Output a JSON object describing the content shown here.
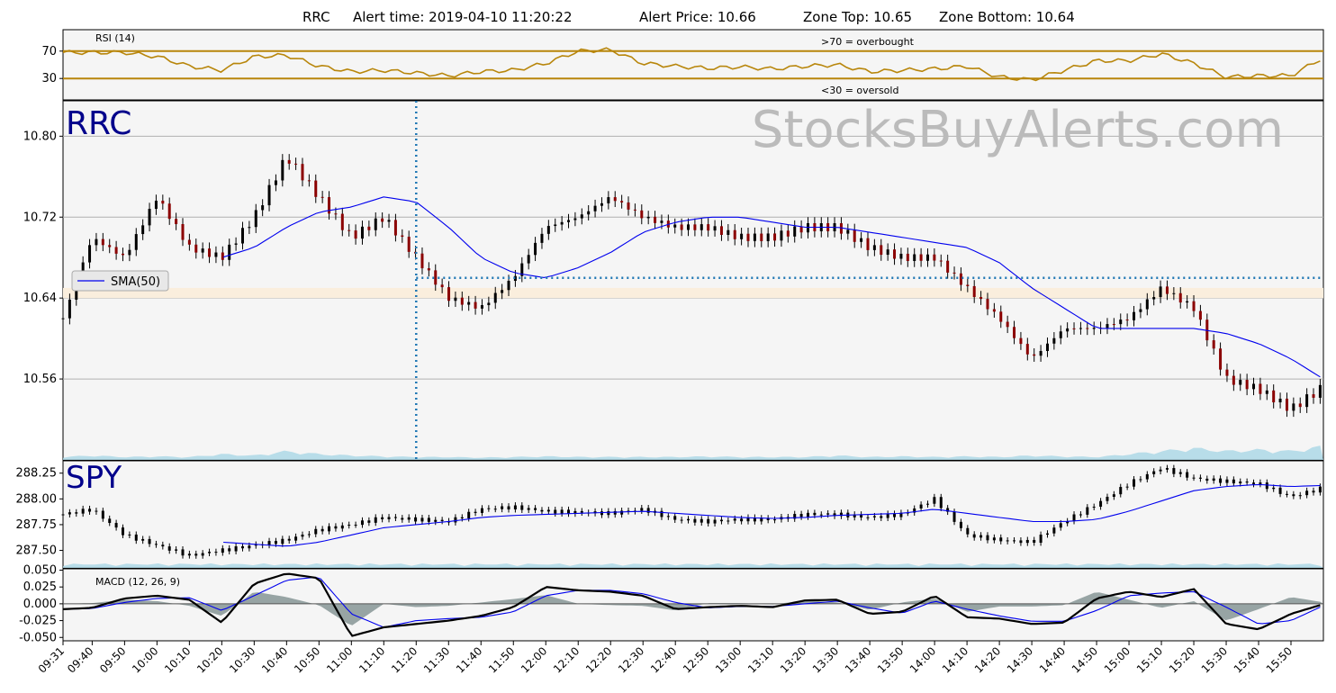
{
  "header": {
    "symbol": "RRC",
    "alert_time_text": "Alert time: 2019-04-10 11:20:22",
    "alert_price_text": "Alert Price: 10.66",
    "zone_top_text": "Zone Top: 10.65",
    "zone_bottom_text": "Zone Bottom: 10.64"
  },
  "watermark": "StocksBuyAlerts.com",
  "colors": {
    "panel_bg": "#f5f5f5",
    "rsi_line": "#b8860b",
    "sma_line": "#0000ee",
    "volume_fill": "#add8e6",
    "zone_fill": "#faeedd",
    "alert_line": "#1f77b4",
    "macd_line": "#000000",
    "signal_line": "#0000ee",
    "hist_fill": "#7f9090",
    "symbol_text": "#00008b",
    "watermark_text": "#bbbbbb"
  },
  "chart_data": [
    {
      "panel": "rsi",
      "type": "line",
      "title": "RSI (14)",
      "yticks": [
        "70",
        "30"
      ],
      "ylim": [
        0,
        100
      ],
      "levels": [
        70,
        30
      ],
      "overbought_text": ">70 = overbought",
      "oversold_text": "<30 = oversold",
      "x": [
        "09:31",
        "09:40",
        "09:50",
        "10:00",
        "10:10",
        "10:20",
        "10:30",
        "10:40",
        "10:50",
        "11:00",
        "11:10",
        "11:20",
        "11:30",
        "11:40",
        "11:50",
        "12:00",
        "12:10",
        "12:20",
        "12:30",
        "12:40",
        "12:50",
        "13:00",
        "13:10",
        "13:20",
        "13:30",
        "13:40",
        "13:50",
        "14:00",
        "14:10",
        "14:20",
        "14:30",
        "14:40",
        "14:50",
        "15:00",
        "15:10",
        "15:20",
        "15:30",
        "15:40",
        "15:50",
        "15:59"
      ],
      "values": [
        68,
        68,
        68,
        62,
        48,
        42,
        62,
        64,
        48,
        40,
        42,
        38,
        34,
        40,
        42,
        52,
        70,
        72,
        52,
        48,
        45,
        47,
        44,
        48,
        50,
        40,
        42,
        44,
        48,
        32,
        28,
        42,
        56,
        56,
        66,
        52,
        32,
        34,
        34,
        58
      ]
    },
    {
      "panel": "price",
      "type": "candlestick",
      "symbol_label": "RRC",
      "yticks": [
        "10.80",
        "10.72",
        "10.64",
        "10.56"
      ],
      "ylim": [
        10.48,
        10.835
      ],
      "legend": "SMA(50)",
      "legend_position": "left",
      "alert_time": "11:20",
      "alert_price": 10.66,
      "zone": [
        10.64,
        10.65
      ],
      "x": [
        "09:31",
        "09:40",
        "09:50",
        "10:00",
        "10:10",
        "10:20",
        "10:30",
        "10:40",
        "10:50",
        "11:00",
        "11:10",
        "11:20",
        "11:30",
        "11:40",
        "11:50",
        "12:00",
        "12:10",
        "12:20",
        "12:30",
        "12:40",
        "12:50",
        "13:00",
        "13:10",
        "13:20",
        "13:30",
        "13:40",
        "13:50",
        "14:00",
        "14:10",
        "14:20",
        "14:30",
        "14:40",
        "14:50",
        "15:00",
        "15:10",
        "15:20",
        "15:30",
        "15:40",
        "15:50",
        "15:59"
      ],
      "close": [
        10.62,
        10.7,
        10.68,
        10.74,
        10.69,
        10.68,
        10.72,
        10.78,
        10.74,
        10.7,
        10.72,
        10.68,
        10.64,
        10.63,
        10.66,
        10.71,
        10.72,
        10.74,
        10.72,
        10.71,
        10.71,
        10.7,
        10.7,
        10.71,
        10.71,
        10.69,
        10.68,
        10.68,
        10.65,
        10.62,
        10.58,
        10.61,
        10.61,
        10.62,
        10.65,
        10.63,
        10.56,
        10.55,
        10.53,
        10.55
      ],
      "sma": [
        null,
        null,
        null,
        null,
        null,
        10.68,
        10.69,
        10.71,
        10.725,
        10.73,
        10.74,
        10.735,
        10.71,
        10.68,
        10.665,
        10.66,
        10.67,
        10.685,
        10.705,
        10.715,
        10.72,
        10.72,
        10.715,
        10.71,
        10.71,
        10.705,
        10.7,
        10.695,
        10.69,
        10.675,
        10.65,
        10.63,
        10.61,
        10.61,
        10.61,
        10.61,
        10.605,
        10.595,
        10.58,
        10.562
      ],
      "volume_relative": [
        0.1,
        0.15,
        0.1,
        0.12,
        0.1,
        0.2,
        0.15,
        0.3,
        0.2,
        0.15,
        0.12,
        0.1,
        0.1,
        0.08,
        0.1,
        0.12,
        0.1,
        0.1,
        0.1,
        0.1,
        0.12,
        0.1,
        0.1,
        0.1,
        0.15,
        0.1,
        0.12,
        0.1,
        0.12,
        0.1,
        0.15,
        0.12,
        0.1,
        0.2,
        0.3,
        0.4,
        0.3,
        0.35,
        0.3,
        0.45
      ]
    },
    {
      "panel": "spy",
      "type": "candlestick",
      "symbol_label": "SPY",
      "yticks": [
        "288.25",
        "288.00",
        "287.75",
        "287.50"
      ],
      "ylim": [
        287.33,
        288.37
      ],
      "x": [
        "09:31",
        "09:40",
        "09:50",
        "10:00",
        "10:10",
        "10:20",
        "10:30",
        "10:40",
        "10:50",
        "11:00",
        "11:10",
        "11:20",
        "11:30",
        "11:40",
        "11:50",
        "12:00",
        "12:10",
        "12:20",
        "12:30",
        "12:40",
        "12:50",
        "13:00",
        "13:10",
        "13:20",
        "13:30",
        "13:40",
        "13:50",
        "14:00",
        "14:10",
        "14:20",
        "14:30",
        "14:40",
        "14:50",
        "15:00",
        "15:10",
        "15:20",
        "15:30",
        "15:40",
        "15:50",
        "15:59"
      ],
      "close": [
        287.85,
        287.9,
        287.65,
        287.55,
        287.45,
        287.5,
        287.55,
        287.6,
        287.7,
        287.75,
        287.82,
        287.8,
        287.78,
        287.9,
        287.92,
        287.88,
        287.87,
        287.86,
        287.9,
        287.8,
        287.78,
        287.8,
        287.8,
        287.85,
        287.85,
        287.82,
        287.85,
        288.0,
        287.65,
        287.6,
        287.58,
        287.78,
        287.95,
        288.15,
        288.3,
        288.2,
        288.17,
        288.15,
        288.02,
        288.1
      ],
      "sma": [
        null,
        null,
        null,
        null,
        null,
        287.58,
        287.56,
        287.54,
        287.58,
        287.65,
        287.72,
        287.75,
        287.78,
        287.82,
        287.84,
        287.85,
        287.86,
        287.87,
        287.88,
        287.86,
        287.84,
        287.82,
        287.81,
        287.82,
        287.84,
        287.85,
        287.86,
        287.9,
        287.86,
        287.82,
        287.78,
        287.78,
        287.8,
        287.88,
        287.98,
        288.08,
        288.12,
        288.14,
        288.12,
        288.13
      ]
    },
    {
      "panel": "macd",
      "type": "line",
      "title": "MACD (12, 26, 9)",
      "yticks": [
        "0.050",
        "0.025",
        "0.000",
        "-0.025",
        "-0.050"
      ],
      "ylim": [
        -0.055,
        0.052
      ],
      "x": [
        "09:31",
        "09:40",
        "09:50",
        "10:00",
        "10:10",
        "10:20",
        "10:30",
        "10:40",
        "10:50",
        "11:00",
        "11:10",
        "11:20",
        "11:30",
        "11:40",
        "11:50",
        "12:00",
        "12:10",
        "12:20",
        "12:30",
        "12:40",
        "12:50",
        "13:00",
        "13:10",
        "13:20",
        "13:30",
        "13:40",
        "13:50",
        "14:00",
        "14:10",
        "14:20",
        "14:30",
        "14:40",
        "14:50",
        "15:00",
        "15:10",
        "15:20",
        "15:30",
        "15:40",
        "15:50",
        "15:59"
      ],
      "macd": [
        -0.008,
        -0.006,
        0.008,
        0.012,
        0.006,
        -0.028,
        0.03,
        0.045,
        0.038,
        -0.048,
        -0.035,
        -0.03,
        -0.025,
        -0.018,
        -0.005,
        0.025,
        0.02,
        0.018,
        0.012,
        -0.008,
        -0.005,
        -0.003,
        -0.005,
        0.005,
        0.006,
        -0.015,
        -0.012,
        0.012,
        -0.02,
        -0.022,
        -0.03,
        -0.028,
        0.008,
        0.018,
        0.01,
        0.022,
        -0.03,
        -0.038,
        -0.015,
        -0.002
      ],
      "signal": [
        -0.008,
        -0.007,
        0.002,
        0.008,
        0.009,
        -0.01,
        0.012,
        0.035,
        0.04,
        -0.015,
        -0.035,
        -0.025,
        -0.022,
        -0.02,
        -0.012,
        0.012,
        0.02,
        0.02,
        0.015,
        0.002,
        -0.006,
        -0.004,
        -0.004,
        0.0,
        0.004,
        -0.006,
        -0.014,
        0.004,
        -0.008,
        -0.018,
        -0.026,
        -0.026,
        -0.01,
        0.012,
        0.016,
        0.018,
        -0.005,
        -0.03,
        -0.025,
        -0.005
      ]
    }
  ],
  "xaxis_ticks": [
    "09:31",
    "09:40",
    "09:50",
    "10:00",
    "10:10",
    "10:20",
    "10:30",
    "10:40",
    "10:50",
    "11:00",
    "11:10",
    "11:20",
    "11:30",
    "11:40",
    "11:50",
    "12:00",
    "12:10",
    "12:20",
    "12:30",
    "12:40",
    "12:50",
    "13:00",
    "13:10",
    "13:20",
    "13:30",
    "13:40",
    "13:50",
    "14:00",
    "14:10",
    "14:20",
    "14:30",
    "14:40",
    "14:50",
    "15:00",
    "15:10",
    "15:20",
    "15:30",
    "15:40",
    "15:50"
  ]
}
